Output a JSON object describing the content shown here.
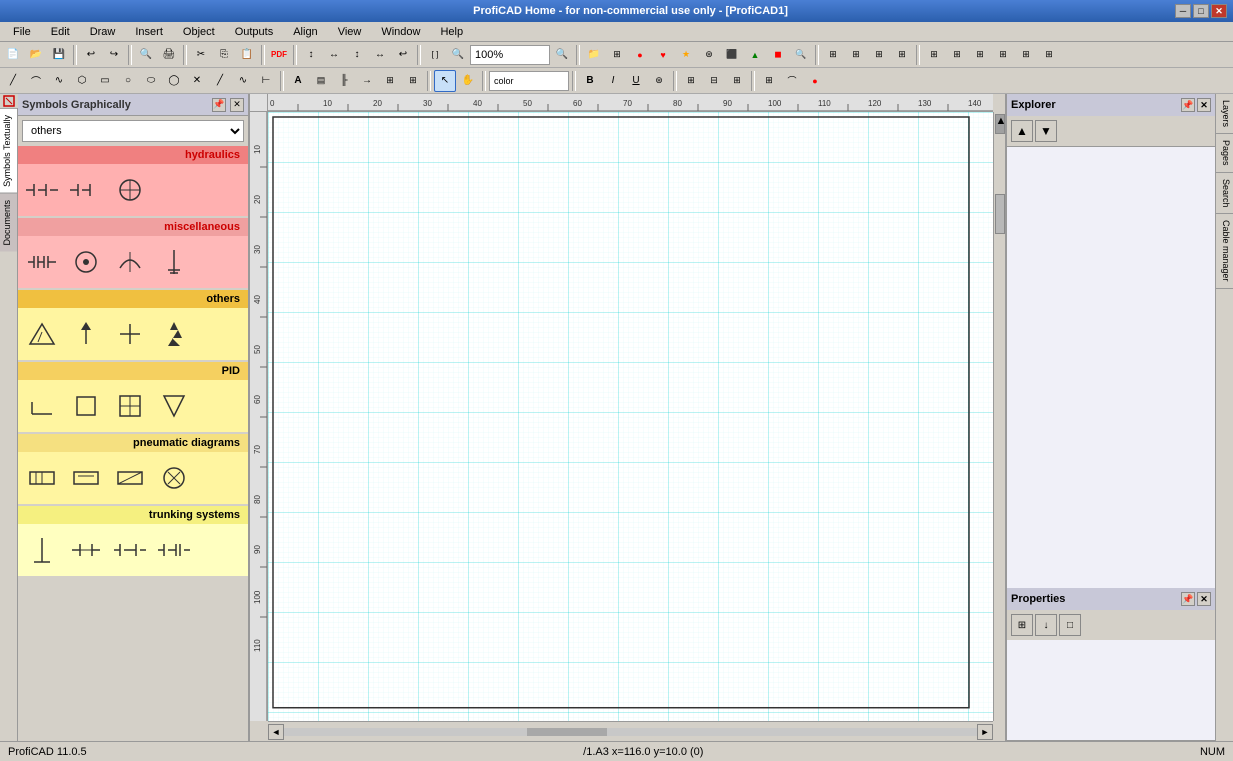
{
  "titleBar": {
    "title": "ProfiCAD Home - for non-commercial use only - [ProfiCAD1]",
    "controls": [
      "minimize",
      "maximize",
      "close"
    ]
  },
  "menuBar": {
    "items": [
      "File",
      "Edit",
      "Draw",
      "Insert",
      "Object",
      "Outputs",
      "Align",
      "View",
      "Window",
      "Help"
    ]
  },
  "toolbar": {
    "zoom_value": "100%"
  },
  "leftPanel": {
    "title": "Symbols Graphically",
    "category": "others",
    "categories": [
      "others",
      "hydraulics",
      "miscellaneous",
      "PID",
      "pneumatic diagrams",
      "trunking systems"
    ],
    "symbolGroups": [
      {
        "name": "hydraulics",
        "cssClass": "hydraulics",
        "gridClass": "",
        "symbols": [
          "⊣⊢",
          "⊣⊣",
          "⊕"
        ]
      },
      {
        "name": "miscellaneous",
        "cssClass": "miscellaneous",
        "gridClass": "",
        "symbols": [
          "⫲",
          "⊙",
          "⌒",
          "⏚"
        ]
      },
      {
        "name": "others",
        "cssClass": "others",
        "gridClass": "yellow",
        "symbols": [
          "△",
          "↑",
          "+",
          "⚡"
        ]
      },
      {
        "name": "PID",
        "cssClass": "pid",
        "gridClass": "yellow",
        "symbols": [
          "⌐",
          "□",
          "⊞",
          "▽"
        ]
      },
      {
        "name": "pneumatic diagrams",
        "cssClass": "pneumatic",
        "gridClass": "yellow",
        "symbols": [
          "⊟",
          "⊞",
          "⊠",
          "◈"
        ]
      },
      {
        "name": "trunking systems",
        "cssClass": "trunking",
        "gridClass": "lightyellow",
        "symbols": [
          "⊥",
          "⊢⊣",
          "├─┤",
          "─┤├─"
        ]
      }
    ]
  },
  "verticalTabsLeft": [
    "Symbols Textually",
    "Documents"
  ],
  "verticalTabsRight": [
    "Layers",
    "Pages",
    "Search",
    "Cable manager"
  ],
  "rightPanel": {
    "explorerTitle": "Explorer",
    "explorerNavUp": "▲",
    "explorerNavDown": "▼",
    "propertiesTitle": "Properties",
    "propertyBtns": [
      "⊞",
      "↓",
      "□"
    ]
  },
  "statusBar": {
    "left": "ProfiCAD 11.0.5",
    "middle": "/1.A3  x=116.0  y=10.0  (0)",
    "right": "NUM"
  },
  "ruler": {
    "topMarks": [
      0,
      10,
      20,
      30,
      40,
      50,
      60,
      70,
      80,
      90,
      100,
      110,
      120,
      130,
      140
    ],
    "leftMarks": [
      10,
      20,
      30,
      40,
      50,
      60,
      70,
      80,
      90,
      100,
      110
    ]
  }
}
